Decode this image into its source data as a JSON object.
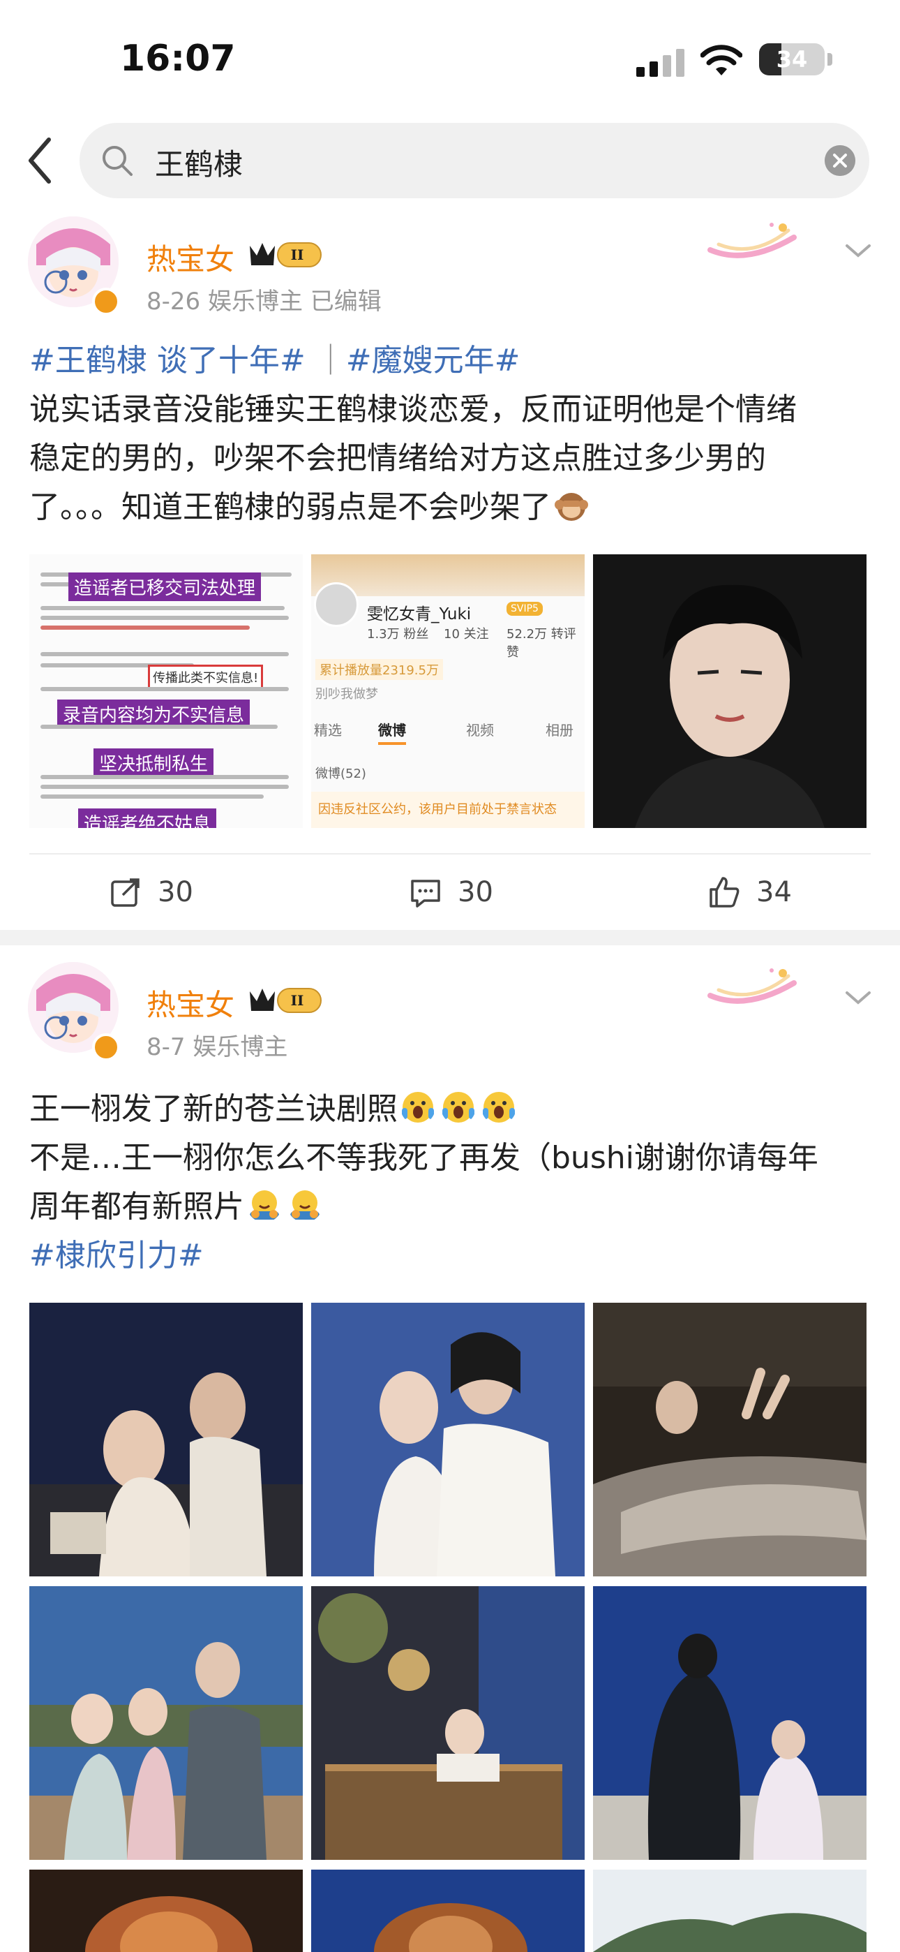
{
  "status_bar": {
    "time": "16:07",
    "battery": "34",
    "battery_level": 0.34
  },
  "search": {
    "query": "王鹤棣"
  },
  "posts": [
    {
      "username": "热宝女",
      "level_badge": "II",
      "meta": "8-26  娱乐博主  已编辑",
      "lines": [
        {
          "tags": [
            "#王鹤棣 谈了十年#",
            "#魔嫂元年#"
          ]
        },
        "说实话录音没能锤实王鹤棣谈恋爱，反而证明他是个情绪",
        "稳定的男的，吵架不会把情绪给对方这点胜过多少男的",
        "了。。。知道王鹤棣的弱点是不会吵架了"
      ],
      "images": {
        "doc": {
          "labels": [
            "造谣者已移交司法处理",
            "录音内容均为不实信息",
            "坚决抵制私生",
            "造谣者绝不姑息"
          ],
          "redbox": "传播此类不实信息!"
        },
        "profile": {
          "name": "雯忆女青_Yuki",
          "vip": "SVIP5",
          "fans": "1.3万 粉丝",
          "follow": "10 关注",
          "likes": "52.2万 转评赞",
          "cumulative": "累计播放量2319.5万",
          "bio": "别吵我做梦",
          "tabs": [
            "精选",
            "微博",
            "视频",
            "相册"
          ],
          "weibo_count": "微博(52)",
          "notice": "因违反社区公约，该用户目前处于禁言状态"
        }
      },
      "actions": {
        "repost": "30",
        "comment": "30",
        "like": "34"
      }
    },
    {
      "username": "热宝女",
      "level_badge": "II",
      "meta": "8-7  娱乐博主",
      "lines": [
        "王一栩发了新的苍兰诀剧照",
        "不是…王一栩你怎么不等我死了再发（bushi谢谢你请每年",
        "周年都有新照片"
      ],
      "tag": "#棣欣引力#"
    }
  ],
  "colors": {
    "username": "#f0800c",
    "hashtag": "#3f6eb6",
    "meta": "#999999"
  }
}
